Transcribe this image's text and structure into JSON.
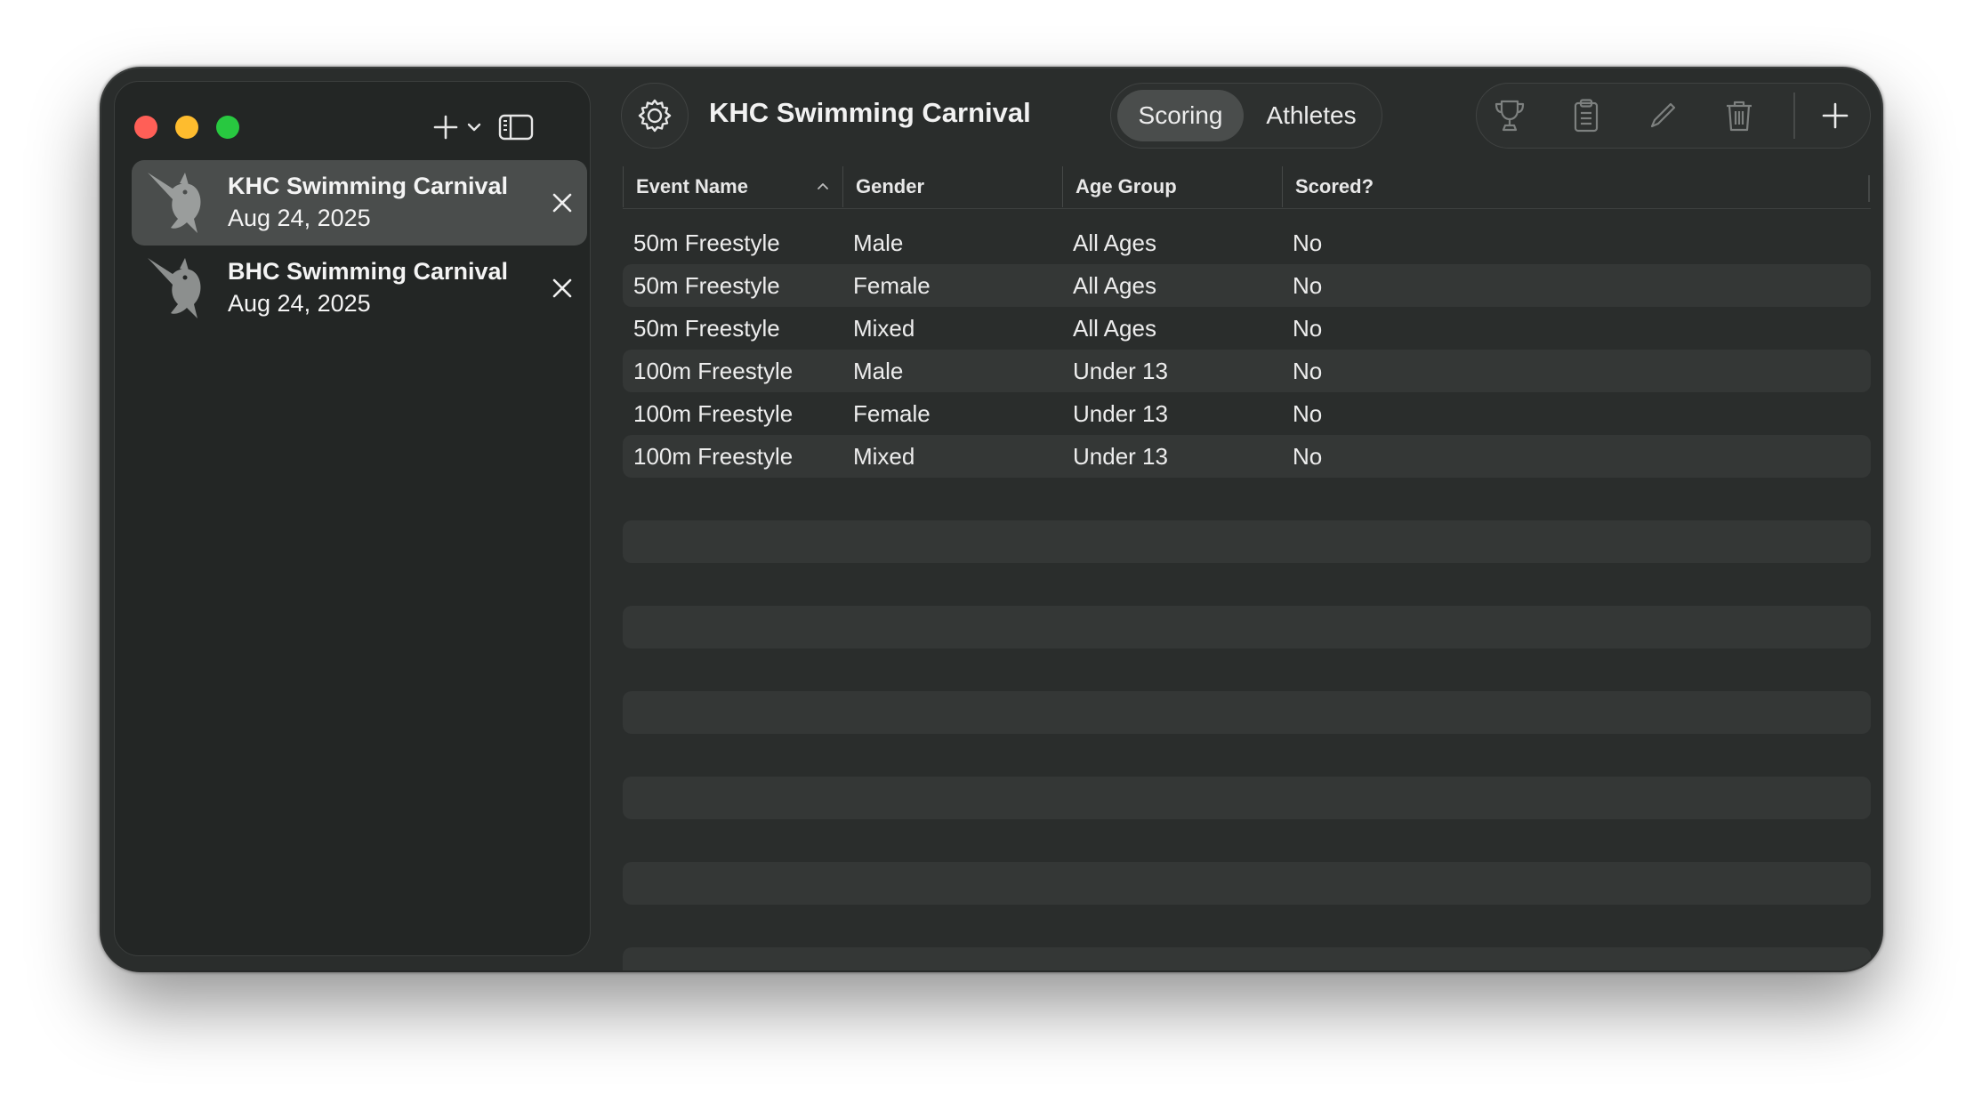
{
  "window": {
    "title": "KHC Swimming Carnival"
  },
  "sidebar": {
    "items": [
      {
        "title": "KHC Swimming Carnival",
        "date": "Aug 24, 2025",
        "selected": true
      },
      {
        "title": "BHC Swimming Carnival",
        "date": "Aug 24, 2025",
        "selected": false
      }
    ]
  },
  "toolbar": {
    "segments": [
      {
        "label": "Scoring",
        "active": true
      },
      {
        "label": "Athletes",
        "active": false
      }
    ],
    "icons": [
      "trophy-icon",
      "clipboard-icon",
      "pencil-icon",
      "trash-icon",
      "plus-icon"
    ]
  },
  "table": {
    "columns": [
      "Event Name",
      "Gender",
      "Age Group",
      "Scored?"
    ],
    "sort_column": "Event Name",
    "sort_direction": "ascending",
    "rows": [
      [
        "50m Freestyle",
        "Male",
        "All Ages",
        "No"
      ],
      [
        "50m Freestyle",
        "Female",
        "All Ages",
        "No"
      ],
      [
        "50m Freestyle",
        "Mixed",
        "All Ages",
        "No"
      ],
      [
        "100m Freestyle",
        "Male",
        "Under 13",
        "No"
      ],
      [
        "100m Freestyle",
        "Female",
        "Under 13",
        "No"
      ],
      [
        "100m Freestyle",
        "Mixed",
        "Under 13",
        "No"
      ]
    ]
  },
  "colors": {
    "traffic_close": "#ff5f57",
    "traffic_minimize": "#febc2e",
    "traffic_zoom": "#28c840",
    "window_bg": "#2a2d2c",
    "selection": "#4a4d4c"
  }
}
